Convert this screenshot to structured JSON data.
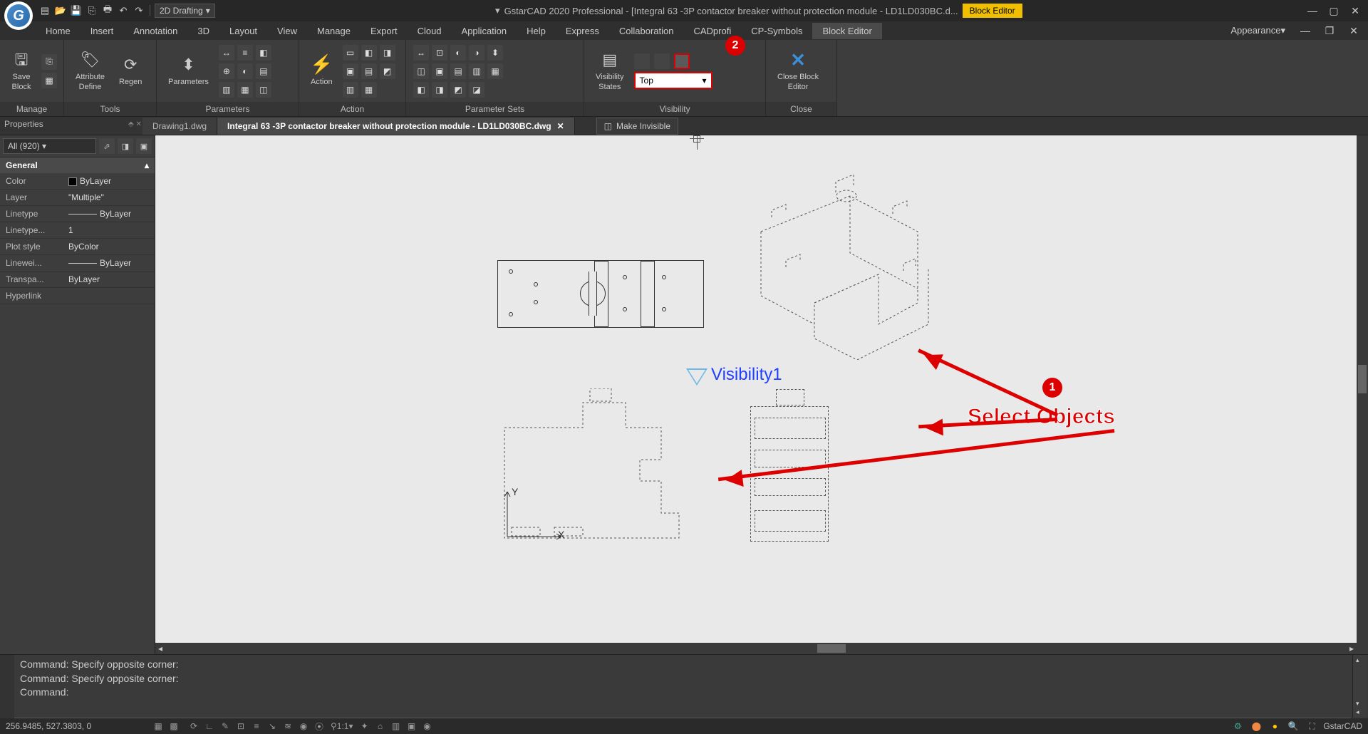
{
  "titlebar": {
    "workspace": "2D Drafting",
    "app_title": "GstarCAD 2020 Professional - [Integral 63 -3P contactor breaker without protection module - LD1LD030BC.d...",
    "mode_badge": "Block Editor"
  },
  "menu": {
    "items": [
      "Home",
      "Insert",
      "Annotation",
      "3D",
      "Layout",
      "View",
      "Manage",
      "Export",
      "Cloud",
      "Application",
      "Help",
      "Express",
      "Collaboration",
      "CADprofi",
      "CP-Symbols",
      "Block Editor"
    ],
    "active": "Block Editor",
    "appearance": "Appearance"
  },
  "ribbon": {
    "panels": {
      "manage": {
        "title": "Manage",
        "save": "Save\nBlock"
      },
      "tools": {
        "title": "Tools",
        "attr": "Attribute\nDefine",
        "regen": "Regen"
      },
      "parameters": {
        "title": "Parameters",
        "label": "Parameters"
      },
      "action": {
        "title": "Action",
        "label": "Action"
      },
      "psets": {
        "title": "Parameter Sets"
      },
      "visibility": {
        "title": "Visibility",
        "states": "Visibility\nStates",
        "dropdown": "Top"
      },
      "close": {
        "title": "Close",
        "label": "Close Block\nEditor"
      }
    }
  },
  "doctabs": {
    "tab1": "Drawing1.dwg",
    "tab2": "Integral 63 -3P contactor breaker without protection module - LD1LD030BC.dwg",
    "float": "Make Invisible"
  },
  "properties": {
    "title": "Properties",
    "selector": "All (920)",
    "section": "General",
    "rows": [
      {
        "k": "Color",
        "v": "ByLayer"
      },
      {
        "k": "Layer",
        "v": "\"Multiple\""
      },
      {
        "k": "Linetype",
        "v": "ByLayer"
      },
      {
        "k": "Linetype...",
        "v": "1"
      },
      {
        "k": "Plot style",
        "v": "ByColor"
      },
      {
        "k": "Linewei...",
        "v": "ByLayer"
      },
      {
        "k": "Transpa...",
        "v": "ByLayer"
      },
      {
        "k": "Hyperlink",
        "v": ""
      }
    ]
  },
  "canvas": {
    "visibility_param": "Visibility1",
    "annotation": "Select Objects",
    "step1": "1",
    "step2": "2",
    "axis_y": "Y",
    "axis_x": "X"
  },
  "command": {
    "line1": "Command: Specify opposite corner:",
    "line2": "Command: Specify opposite corner:",
    "line3": "Command:"
  },
  "status": {
    "coords": "256.9485, 527.3803, 0",
    "scale": "1:1",
    "brand": "GstarCAD"
  }
}
